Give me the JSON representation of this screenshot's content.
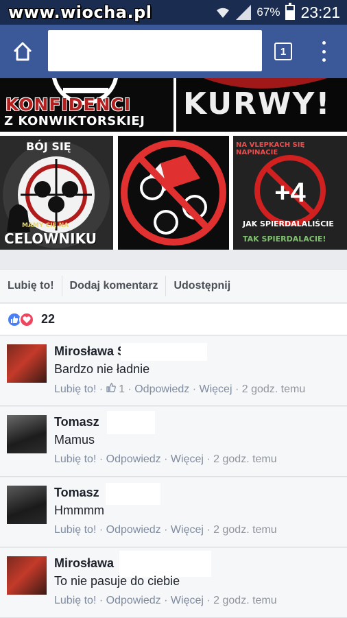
{
  "status_bar": {
    "watermark": "www.wiocha.pl",
    "battery": "67%",
    "time": "23:21",
    "icons": [
      "wifi-icon",
      "signal-icon",
      "battery-icon"
    ]
  },
  "browser": {
    "tab_count": "1",
    "icons": [
      "home-icon",
      "more-vert-icon"
    ]
  },
  "photos": {
    "photo1": {
      "line1": "KONFIDENCI",
      "line2": "Z KONWIKTORSKIEJ"
    },
    "photo2": {
      "text": "KURWY!"
    },
    "photo3": {
      "top": "BÓJ SIĘ",
      "sub": "MAMY CIĘ NA",
      "bottom": "CELOWNIKU"
    },
    "photo5": {
      "top": "NA VLEPKACH SIĘ NAPINACIE",
      "mid": "JAK SPIERDALALIŚCIE",
      "bottom": "TAK SPIERDALACIE!",
      "more": "+4"
    }
  },
  "actions": {
    "like": "Lubię to!",
    "comment": "Dodaj komentarz",
    "share": "Udostępnij"
  },
  "reactions": {
    "count": "22",
    "types": [
      "like-reaction-icon",
      "love-reaction-icon"
    ]
  },
  "comments": [
    {
      "name": "Mirosława S",
      "text": "Bardzo nie ładnie",
      "like": "Lubię to!",
      "likes": "1",
      "reply": "Odpowiedz",
      "more": "Więcej",
      "time": "2 godz. temu"
    },
    {
      "name": "Tomasz",
      "text": "Mamus",
      "like": "Lubię to!",
      "reply": "Odpowiedz",
      "more": "Więcej",
      "time": "2 godz. temu"
    },
    {
      "name": "Tomasz",
      "text": "Hmmmm",
      "like": "Lubię to!",
      "reply": "Odpowiedz",
      "more": "Więcej",
      "time": "2 godz. temu"
    },
    {
      "name": "Mirosława",
      "text": "To nie pasuje do ciebie",
      "like": "Lubię to!",
      "reply": "Odpowiedz",
      "more": "Więcej",
      "time": "2 godz. temu"
    }
  ],
  "separator": "·",
  "colors": {
    "navbar": "#3b5998",
    "statusbar": "#1a2c50",
    "link": "#7f8b9f",
    "like_blue": "#4a80f5",
    "love_red": "#f0455e"
  }
}
